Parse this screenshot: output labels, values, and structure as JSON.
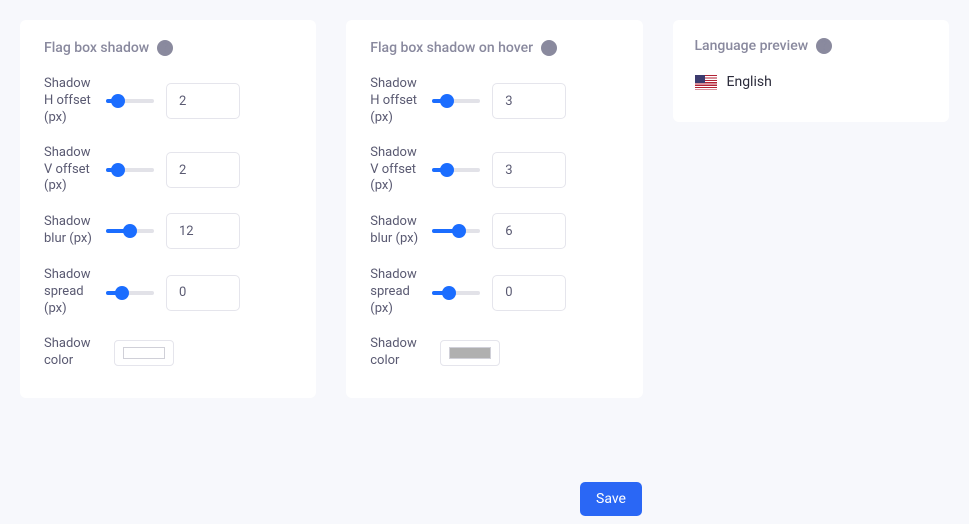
{
  "shadow": {
    "title": "Flag box shadow",
    "h_offset_label": "Shadow H offset (px)",
    "h_offset_value": "2",
    "v_offset_label": "Shadow V offset (px)",
    "v_offset_value": "2",
    "blur_label": "Shadow blur (px)",
    "blur_value": "12",
    "spread_label": "Shadow spread (px)",
    "spread_value": "0",
    "color_label": "Shadow color",
    "color_value": "#eeeeee"
  },
  "shadow_hover": {
    "title": "Flag box shadow on hover",
    "h_offset_label": "Shadow H offset (px)",
    "h_offset_value": "3",
    "v_offset_label": "Shadow V offset (px)",
    "v_offset_value": "3",
    "blur_label": "Shadow blur (px)",
    "blur_value": "6",
    "spread_label": "Shadow spread (px)",
    "spread_value": "0",
    "color_label": "Shadow color",
    "color_value": "#b0b0b0"
  },
  "preview": {
    "title": "Language preview",
    "language": "English"
  },
  "actions": {
    "save": "Save"
  }
}
